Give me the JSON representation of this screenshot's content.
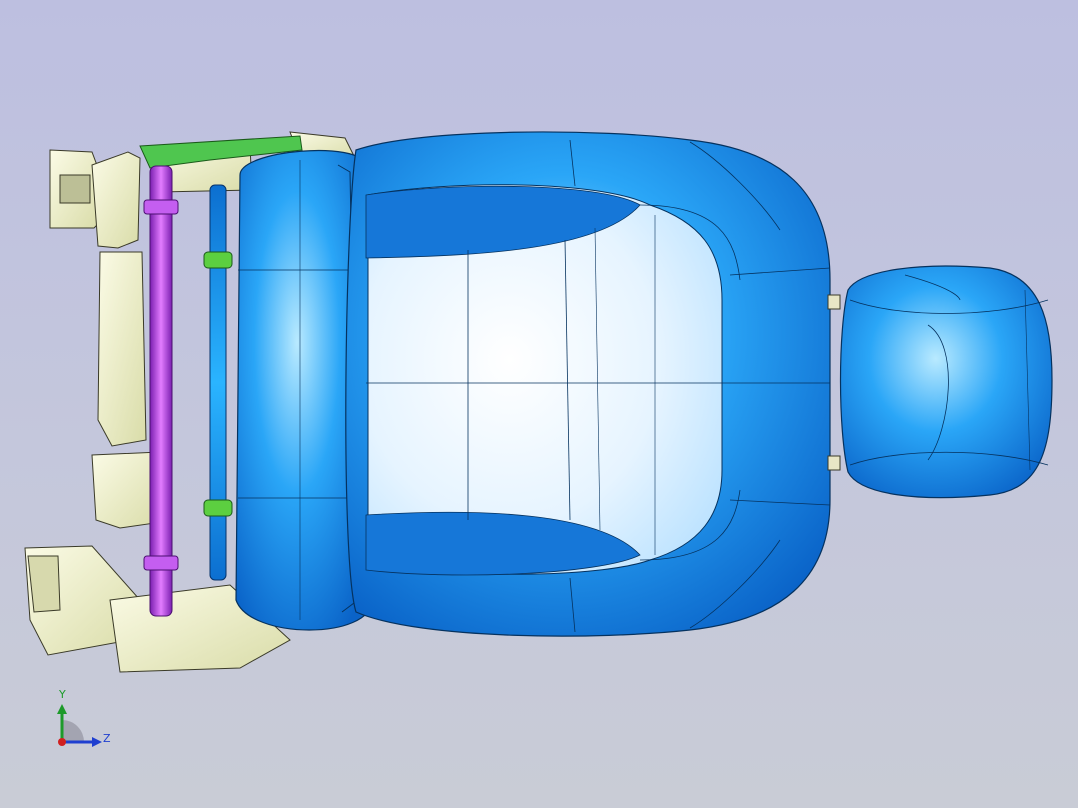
{
  "viewport": {
    "background_top": "#bdbfe0",
    "background_bottom": "#c9ccd6"
  },
  "model": {
    "parts": [
      {
        "name": "seat-cushion",
        "color": "#1e90f5"
      },
      {
        "name": "seat-back",
        "color": "#1e90f5"
      },
      {
        "name": "headrest",
        "color": "#1e90f5"
      },
      {
        "name": "seat-frame",
        "color": "#eef0c8"
      },
      {
        "name": "cross-tube",
        "color": "#b040e0"
      },
      {
        "name": "bracket",
        "color": "#3cc03c"
      }
    ]
  },
  "triad": {
    "y_label": "Y",
    "z_label": "Z",
    "y_color": "#1d9a2a",
    "z_color": "#1f3fd0",
    "x_color": "#d02020"
  }
}
